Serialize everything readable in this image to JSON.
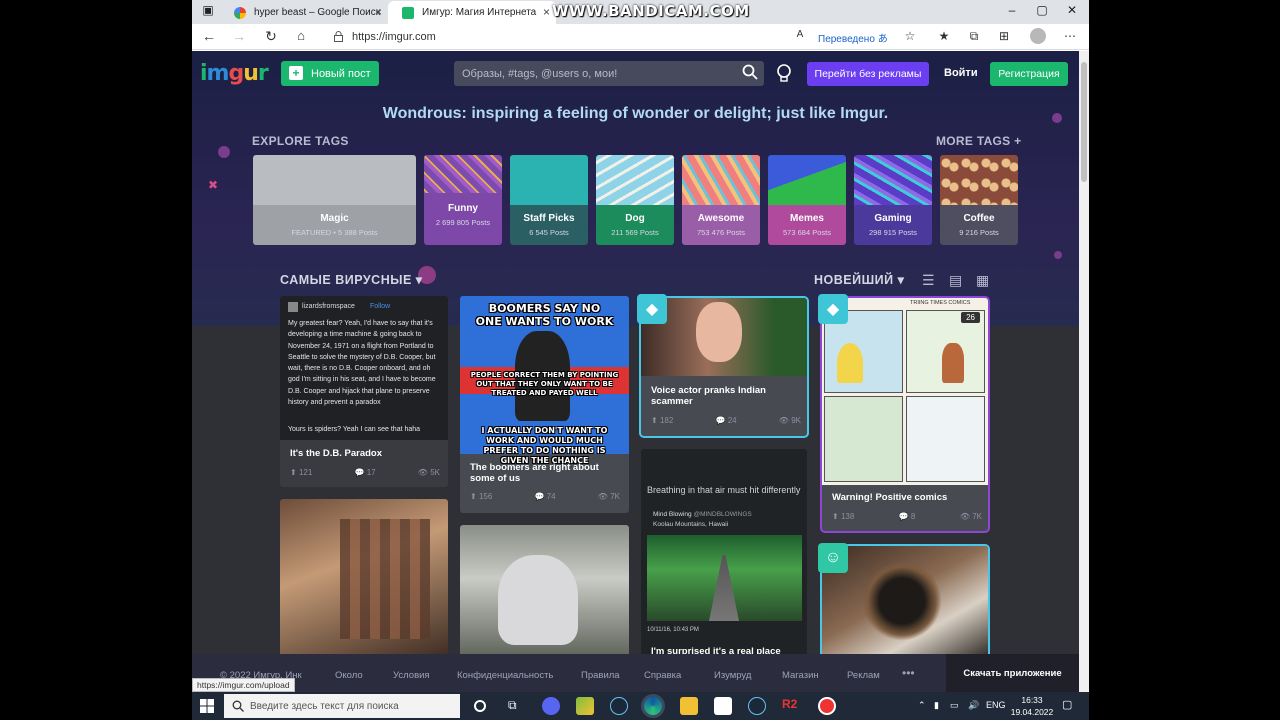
{
  "browser": {
    "tabs": [
      {
        "title": "hyper beast – Google Поиск"
      },
      {
        "title": "Имгур: Магия Интернета"
      }
    ],
    "tab_close": "×",
    "window_controls": {
      "minimize": "–",
      "maximize": "▢",
      "close": "✕"
    },
    "recorder_watermark": "WWW.BANDICAM.COM",
    "url": "https://imgur.com",
    "verified_label": "Переведено",
    "status_url": "https://imgur.com/upload"
  },
  "header": {
    "logo_letters": [
      "i",
      "m",
      "g",
      "u",
      "r"
    ],
    "new_post_label": "Новый пост",
    "search_placeholder": "Образы, #tags, @users о, мои!",
    "no_ads_label": "Перейти без рекламы",
    "login_label": "Войти",
    "register_label": "Регистрация"
  },
  "hero": {
    "headline": "Wondrous: inspiring a feeling of wonder or delight; just like Imgur.",
    "explore_label": "EXPLORE TAGS",
    "more_tags_label": "MORE TAGS +"
  },
  "tags": [
    {
      "name": "Magic",
      "count": "FEATURED • 5 388 Posts"
    },
    {
      "name": "Funny",
      "count": "2 699 805 Posts"
    },
    {
      "name": "Staff Picks",
      "count": "6 545 Posts"
    },
    {
      "name": "Dog",
      "count": "211 569 Posts"
    },
    {
      "name": "Awesome",
      "count": "753 476 Posts"
    },
    {
      "name": "Memes",
      "count": "573 684 Posts"
    },
    {
      "name": "Gaming",
      "count": "298 915 Posts"
    },
    {
      "name": "Coffee",
      "count": "9 216 Posts"
    }
  ],
  "feed": {
    "sort_viral": "САМЫЕ ВИРУСНЫЕ",
    "sort_newest": "НОВЕЙШИЙ",
    "posts": [
      {
        "title": "It's the D.B. Paradox",
        "ups": "121",
        "comments": "17",
        "views": "5K",
        "author": "lizardsfromspace",
        "follow": "Follow",
        "body": "My greatest fear? Yeah, I'd have to say that it's developing a time machine & going back to November 24, 1971 on a flight from Portland to Seattle to solve the mystery of D.B. Cooper, but wait, there is no D.B. Cooper onboard, and oh god I'm sitting in his seat, and I have to become D.B. Cooper and hijack that plane to preserve history and prevent a paradox",
        "body2": "Yours is spiders? Yeah I can see that haha"
      },
      {
        "title": "The boomers are right about some of us",
        "ups": "156",
        "comments": "74",
        "views": "7K",
        "meme_top": "BOOMERS SAY NO ONE WANTS TO WORK",
        "meme_mid": "PEOPLE CORRECT THEM BY POINTING OUT THAT THEY ONLY WANT TO BE TREATED AND PAYED WELL",
        "meme_bot": "I ACTUALLY DON'T WANT TO WORK AND WOULD MUCH PREFER TO DO NOTHING IS GIVEN THE CHANCE"
      },
      {
        "title": "Voice actor pranks Indian scammer",
        "ups": "182",
        "comments": "24",
        "views": "9K"
      },
      {
        "title": "Warning! Positive comics",
        "ups": "138",
        "comments": "8",
        "views": "7K",
        "counter": "26",
        "comic_header": "TRIING TIMES COMICS"
      },
      {
        "caption": "Breathing in that air must hit differently",
        "source_name": "Mind Blowing",
        "source_handle": "@MINDBLOWINGS",
        "location": "Koolau Mountains, Hawaii",
        "date": "10/11/16, 10:43 PM",
        "title": "I'm surprised it's a real place lol....."
      }
    ]
  },
  "footer": {
    "copyright": "© 2022 Имгур, Инк",
    "links": [
      "Около",
      "Условия",
      "Конфиденциальность",
      "Правила",
      "Справка",
      "Изумруд",
      "Магазин",
      "Реклам"
    ],
    "more": "•••",
    "app_label": "Скачать приложение"
  },
  "taskbar": {
    "search_placeholder": "Введите здесь текст для поиска",
    "lang": "ENG",
    "time": "16:33",
    "date": "19.04.2022"
  },
  "colors": {
    "brand_green": "#1bb76e",
    "accent_purple": "#6b3ef2",
    "page_bg": "#27294a"
  }
}
